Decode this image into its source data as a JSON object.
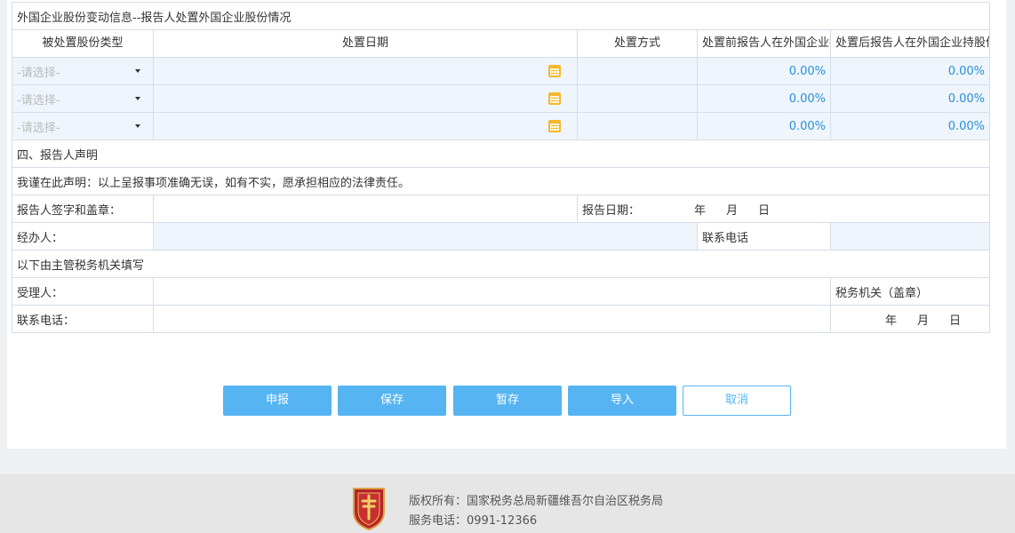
{
  "section_title": "外国企业股份变动信息--报告人处置外国企业股份情况",
  "headers": {
    "share_type": "被处置股份类型",
    "disposal_date": "处置日期",
    "disposal_method": "处置方式",
    "before_share": "处置前报告人在外国企业持股份额",
    "after_share": "处置后报告人在外国企业持股份额"
  },
  "rows": [
    {
      "share_type": "-请选择-",
      "before": "0.00%",
      "after": "0.00%"
    },
    {
      "share_type": "-请选择-",
      "before": "0.00%",
      "after": "0.00%"
    },
    {
      "share_type": "-请选择-",
      "before": "0.00%",
      "after": "0.00%"
    }
  ],
  "declaration": {
    "title": "四、报告人声明",
    "text": "我谨在此声明：以上呈报事项准确无误，如有不实，愿承担相应的法律责任。",
    "signature_label": "报告人签字和盖章：",
    "report_date_label": "报告日期：",
    "year": "年",
    "month": "月",
    "day": "日",
    "handler_label": "经办人：",
    "phone_label": "联系电话",
    "tax_section": "以下由主管税务机关填写",
    "receiver_label": "受理人：",
    "tax_office_label": "税务机关（盖章）",
    "tax_phone_label": "联系电话："
  },
  "buttons": {
    "submit": "申报",
    "save": "保存",
    "temp_save": "暂存",
    "import": "导入",
    "cancel": "取消"
  },
  "footer": {
    "copyright": "版权所有：国家税务总局新疆维吾尔自治区税务局",
    "service_phone": "服务电话：0991-12366"
  },
  "colors": {
    "accent": "#56b4f2",
    "percent": "#2a8fd6",
    "row_bg": "#eef5fd"
  }
}
